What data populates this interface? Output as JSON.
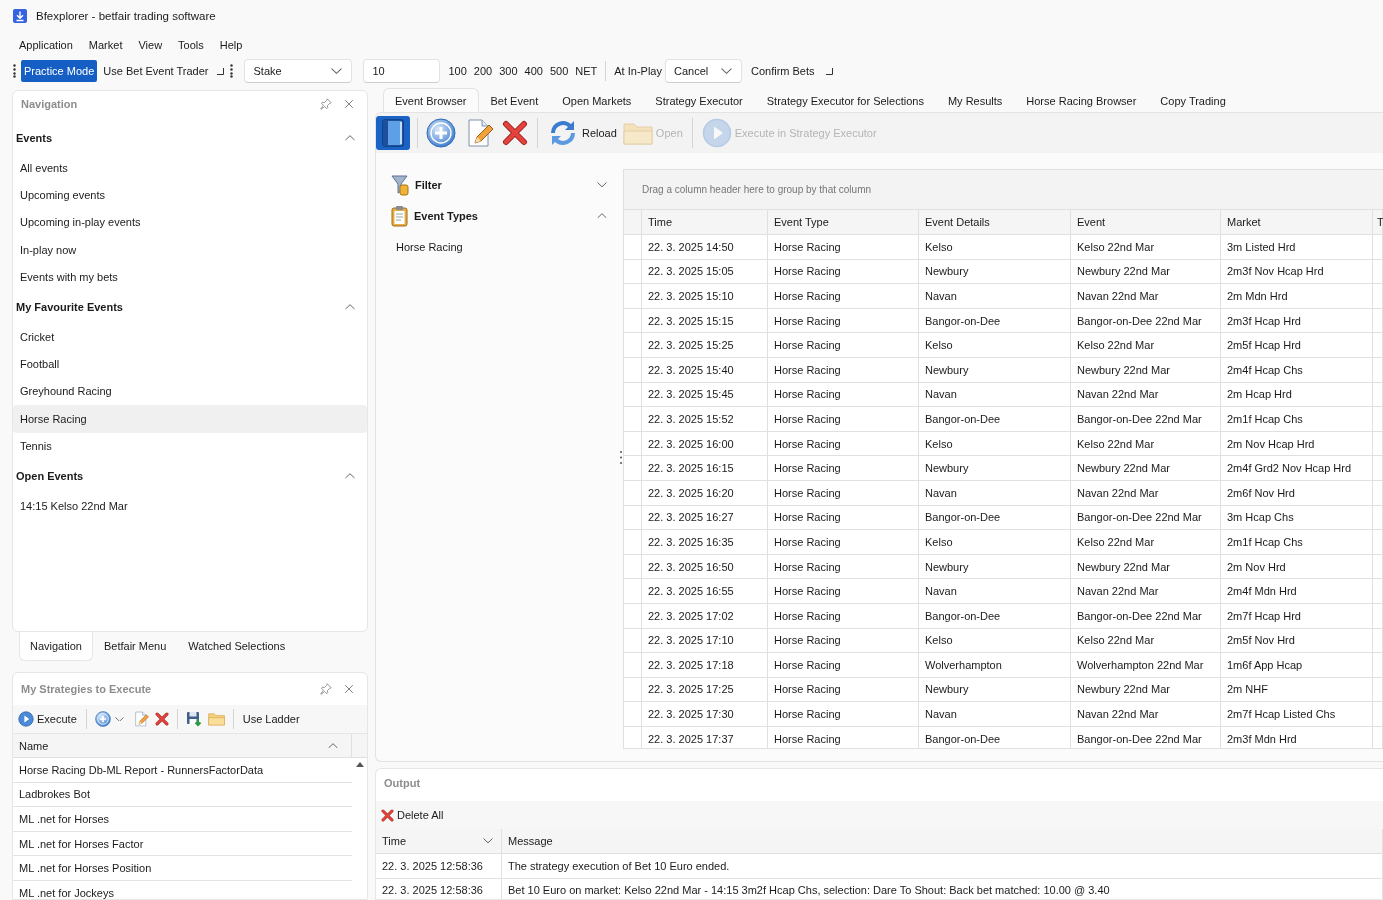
{
  "window": {
    "title": "Bfexplorer - betfair trading software"
  },
  "menu": [
    "Application",
    "Market",
    "View",
    "Tools",
    "Help"
  ],
  "toolbar": {
    "toggles": [
      {
        "label": "Practice Mode",
        "checked": true
      },
      {
        "label": "Use Bet Event Trader",
        "checked": false
      }
    ],
    "stake_type": {
      "value": "Stake"
    },
    "stake": {
      "value": "10"
    },
    "quick_stakes": [
      "100",
      "200",
      "300",
      "400",
      "500",
      "NET"
    ],
    "in_play_label": "At In-Play",
    "in_play_action": {
      "value": "Cancel"
    },
    "confirm_bets": {
      "label": "Confirm Bets",
      "checked": false
    }
  },
  "navigation": {
    "title": "Navigation",
    "sections": [
      {
        "title": "Events",
        "expanded": true,
        "items": [
          {
            "label": "All events",
            "selected": false
          },
          {
            "label": "Upcoming events",
            "selected": false
          },
          {
            "label": "Upcoming in-play events",
            "selected": false
          },
          {
            "label": "In-play now",
            "selected": false
          },
          {
            "label": "Events with my bets",
            "selected": false
          }
        ]
      },
      {
        "title": "My Favourite Events",
        "expanded": true,
        "items": [
          {
            "label": "Cricket",
            "selected": false
          },
          {
            "label": "Football",
            "selected": false
          },
          {
            "label": "Greyhound Racing",
            "selected": false
          },
          {
            "label": "Horse Racing",
            "selected": true
          },
          {
            "label": "Tennis",
            "selected": false
          }
        ]
      },
      {
        "title": "Open Events",
        "expanded": true,
        "items": [
          {
            "label": "14:15 Kelso 22nd Mar",
            "selected": false
          }
        ]
      }
    ],
    "tabs": [
      {
        "label": "Navigation",
        "selected": true
      },
      {
        "label": "Betfair Menu",
        "selected": false
      },
      {
        "label": "Watched Selections",
        "selected": false
      }
    ]
  },
  "strategies": {
    "title": "My Strategies to Execute",
    "toolbar": {
      "execute": "Execute",
      "use_ladder": "Use Ladder"
    },
    "columns": [
      {
        "label": "Name",
        "sorted": true,
        "ascending": true
      }
    ],
    "rows": [
      "Horse Racing Db-ML Report - RunnersFactorData",
      "Ladbrokes Bot",
      "ML .net for Horses",
      "ML .net for Horses Factor",
      "ML .net for Horses Position",
      "ML .net for Jockeys"
    ]
  },
  "document_tabs": [
    {
      "label": "Event Browser",
      "selected": true
    },
    {
      "label": "Bet Event",
      "selected": false
    },
    {
      "label": "Open Markets",
      "selected": false
    },
    {
      "label": "Strategy Executor",
      "selected": false
    },
    {
      "label": "Strategy Executor for Selections",
      "selected": false
    },
    {
      "label": "My Results",
      "selected": false
    },
    {
      "label": "Horse Racing Browser",
      "selected": false
    },
    {
      "label": "Copy Trading",
      "selected": false
    }
  ],
  "event_browser": {
    "toolbar": {
      "browser_toggle": {
        "selected": true
      },
      "actions": [
        {
          "label": "Reload",
          "disabled": false
        },
        {
          "label": "Open",
          "disabled": true
        },
        {
          "label": "Execute in Strategy Executor",
          "disabled": true
        }
      ]
    },
    "filters": [
      {
        "label": "Filter",
        "expanded": false
      },
      {
        "label": "Event Types",
        "expanded": true,
        "items": [
          "Horse Racing"
        ]
      }
    ],
    "grid": {
      "group_hint": "Drag a column header here to group by that column",
      "columns": [
        "Time",
        "Event Type",
        "Event Details",
        "Event",
        "Market",
        "T"
      ],
      "rows": [
        [
          "22. 3. 2025 14:50",
          "Horse Racing",
          "Kelso",
          "Kelso 22nd Mar",
          "3m Listed Hrd"
        ],
        [
          "22. 3. 2025 15:05",
          "Horse Racing",
          "Newbury",
          "Newbury 22nd Mar",
          "2m3f Nov Hcap Hrd"
        ],
        [
          "22. 3. 2025 15:10",
          "Horse Racing",
          "Navan",
          "Navan 22nd Mar",
          "2m Mdn Hrd"
        ],
        [
          "22. 3. 2025 15:15",
          "Horse Racing",
          "Bangor-on-Dee",
          "Bangor-on-Dee 22nd Mar",
          "2m3f Hcap Hrd"
        ],
        [
          "22. 3. 2025 15:25",
          "Horse Racing",
          "Kelso",
          "Kelso 22nd Mar",
          "2m5f Hcap Hrd"
        ],
        [
          "22. 3. 2025 15:40",
          "Horse Racing",
          "Newbury",
          "Newbury 22nd Mar",
          "2m4f Hcap Chs"
        ],
        [
          "22. 3. 2025 15:45",
          "Horse Racing",
          "Navan",
          "Navan 22nd Mar",
          "2m Hcap Hrd"
        ],
        [
          "22. 3. 2025 15:52",
          "Horse Racing",
          "Bangor-on-Dee",
          "Bangor-on-Dee 22nd Mar",
          "2m1f Hcap Chs"
        ],
        [
          "22. 3. 2025 16:00",
          "Horse Racing",
          "Kelso",
          "Kelso 22nd Mar",
          "2m Nov Hcap Hrd"
        ],
        [
          "22. 3. 2025 16:15",
          "Horse Racing",
          "Newbury",
          "Newbury 22nd Mar",
          "2m4f Grd2 Nov Hcap Hrd"
        ],
        [
          "22. 3. 2025 16:20",
          "Horse Racing",
          "Navan",
          "Navan 22nd Mar",
          "2m6f Nov Hrd"
        ],
        [
          "22. 3. 2025 16:27",
          "Horse Racing",
          "Bangor-on-Dee",
          "Bangor-on-Dee 22nd Mar",
          "3m Hcap Chs"
        ],
        [
          "22. 3. 2025 16:35",
          "Horse Racing",
          "Kelso",
          "Kelso 22nd Mar",
          "2m1f Hcap Chs"
        ],
        [
          "22. 3. 2025 16:50",
          "Horse Racing",
          "Newbury",
          "Newbury 22nd Mar",
          "2m Nov Hrd"
        ],
        [
          "22. 3. 2025 16:55",
          "Horse Racing",
          "Navan",
          "Navan 22nd Mar",
          "2m4f Mdn Hrd"
        ],
        [
          "22. 3. 2025 17:02",
          "Horse Racing",
          "Bangor-on-Dee",
          "Bangor-on-Dee 22nd Mar",
          "2m7f Hcap Hrd"
        ],
        [
          "22. 3. 2025 17:10",
          "Horse Racing",
          "Kelso",
          "Kelso 22nd Mar",
          "2m5f Nov Hrd"
        ],
        [
          "22. 3. 2025 17:18",
          "Horse Racing",
          "Wolverhampton",
          "Wolverhampton 22nd Mar",
          "1m6f App Hcap"
        ],
        [
          "22. 3. 2025 17:25",
          "Horse Racing",
          "Newbury",
          "Newbury 22nd Mar",
          "2m NHF"
        ],
        [
          "22. 3. 2025 17:30",
          "Horse Racing",
          "Navan",
          "Navan 22nd Mar",
          "2m7f Hcap Listed Chs"
        ],
        [
          "22. 3. 2025 17:37",
          "Horse Racing",
          "Bangor-on-Dee",
          "Bangor-on-Dee 22nd Mar",
          "2m3f Mdn Hrd"
        ]
      ]
    }
  },
  "output": {
    "title": "Output",
    "delete_all": "Delete All",
    "columns": [
      {
        "label": "Time",
        "sorted": true,
        "ascending": false
      },
      {
        "label": "Message",
        "sorted": false
      }
    ],
    "rows": [
      [
        "22. 3. 2025 12:58:36",
        "The strategy execution of Bet 10 Euro ended."
      ],
      [
        "22. 3. 2025 12:58:36",
        "Bet 10 Euro on market: Kelso 22nd Mar - 14:15 3m2f Hcap Chs, selection: Dare To Shout: Back bet matched: 10.00 @ 3.40"
      ]
    ]
  }
}
